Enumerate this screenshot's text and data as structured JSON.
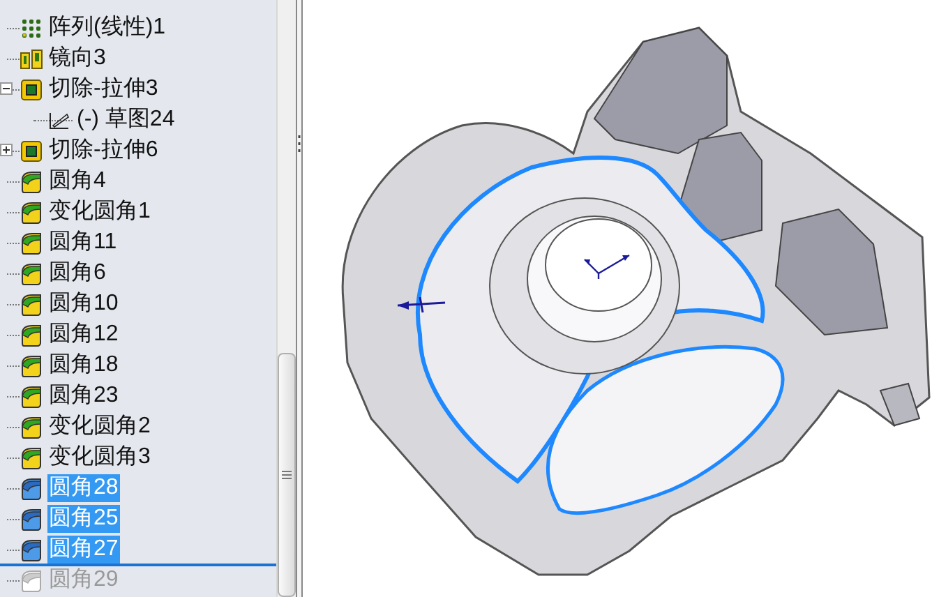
{
  "feature_tree": {
    "items": [
      {
        "kind": "pattern",
        "label": "阵列(线性)1",
        "selected": false,
        "rolled_back": false
      },
      {
        "kind": "mirror",
        "label": "镜向3",
        "selected": false,
        "rolled_back": false
      },
      {
        "kind": "cut",
        "label": "切除-拉伸3",
        "selected": false,
        "rolled_back": false,
        "expanded": true,
        "children": [
          {
            "kind": "sketch",
            "label": "(-) 草图24",
            "selected": false,
            "rolled_back": false
          }
        ]
      },
      {
        "kind": "cut",
        "label": "切除-拉伸6",
        "selected": false,
        "rolled_back": false,
        "expanded": false
      },
      {
        "kind": "fillet",
        "label": "圆角4",
        "selected": false,
        "rolled_back": false
      },
      {
        "kind": "fillet",
        "label": "变化圆角1",
        "selected": false,
        "rolled_back": false
      },
      {
        "kind": "fillet",
        "label": "圆角11",
        "selected": false,
        "rolled_back": false
      },
      {
        "kind": "fillet",
        "label": "圆角6",
        "selected": false,
        "rolled_back": false
      },
      {
        "kind": "fillet",
        "label": "圆角10",
        "selected": false,
        "rolled_back": false
      },
      {
        "kind": "fillet",
        "label": "圆角12",
        "selected": false,
        "rolled_back": false
      },
      {
        "kind": "fillet",
        "label": "圆角18",
        "selected": false,
        "rolled_back": false
      },
      {
        "kind": "fillet",
        "label": "圆角23",
        "selected": false,
        "rolled_back": false
      },
      {
        "kind": "fillet",
        "label": "变化圆角2",
        "selected": false,
        "rolled_back": false
      },
      {
        "kind": "fillet",
        "label": "变化圆角3",
        "selected": false,
        "rolled_back": false
      },
      {
        "kind": "fillet",
        "label": "圆角28",
        "selected": true,
        "rolled_back": false
      },
      {
        "kind": "fillet",
        "label": "圆角25",
        "selected": true,
        "rolled_back": false
      },
      {
        "kind": "fillet",
        "label": "圆角27",
        "selected": true,
        "rolled_back": false
      },
      {
        "kind": "fillet",
        "label": "圆角29",
        "selected": false,
        "rolled_back": true
      }
    ]
  }
}
